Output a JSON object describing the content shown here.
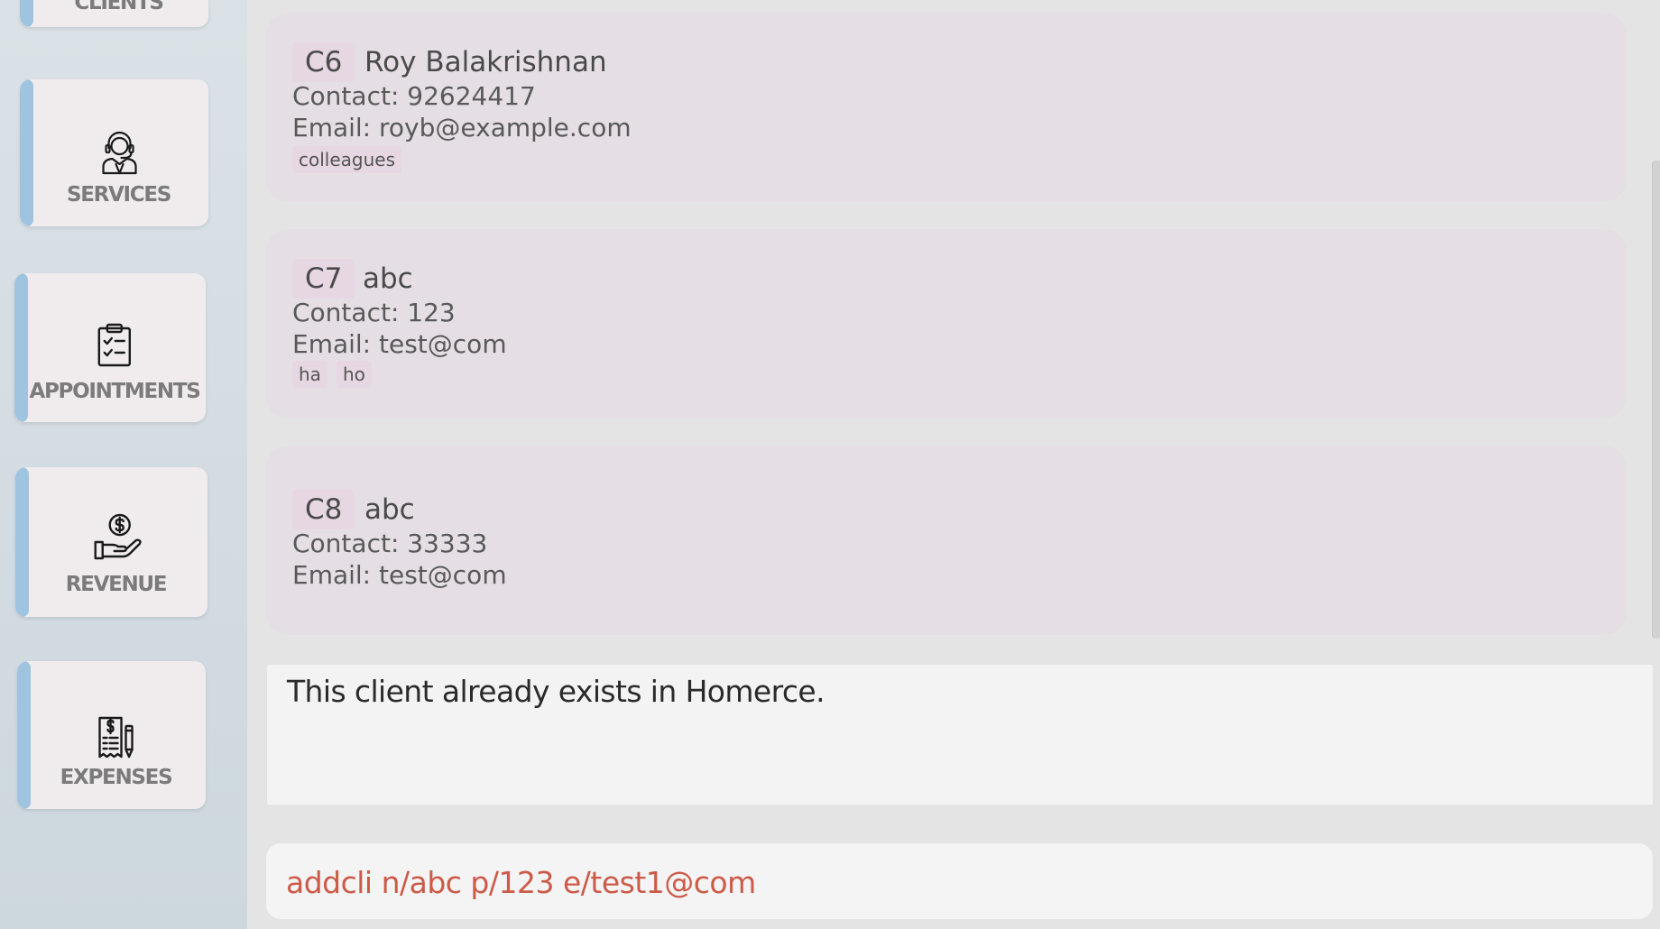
{
  "sidebar": {
    "items": [
      {
        "label": "CLIENTS",
        "icon": "clients-icon"
      },
      {
        "label": "SERVICES",
        "icon": "customer-service-icon"
      },
      {
        "label": "APPOINTMENTS",
        "icon": "clipboard-checklist-icon"
      },
      {
        "label": "REVENUE",
        "icon": "money-hand-icon"
      },
      {
        "label": "EXPENSES",
        "icon": "expense-receipt-icon"
      }
    ]
  },
  "clients": [
    {
      "id": "C6",
      "name": "Roy Balakrishnan",
      "contact": "Contact: 92624417",
      "email": "Email: royb@example.com",
      "tags": [
        "colleagues"
      ]
    },
    {
      "id": "C7",
      "name": "abc",
      "contact": "Contact: 123",
      "email": "Email: test@com",
      "tags": [
        "ha",
        "ho"
      ]
    },
    {
      "id": "C8",
      "name": "abc",
      "contact": "Contact: 33333",
      "email": "Email: test@com",
      "tags": []
    }
  ],
  "result": {
    "message": "This client already exists in Homerce."
  },
  "command": {
    "value": "addcli n/abc p/123 e/test1@com"
  },
  "colors": {
    "accent_stripe": "#9fc4df",
    "card_bg": "#e5dfe5",
    "tag_bg": "#e6d7e3",
    "command_text": "#cc5a48"
  }
}
